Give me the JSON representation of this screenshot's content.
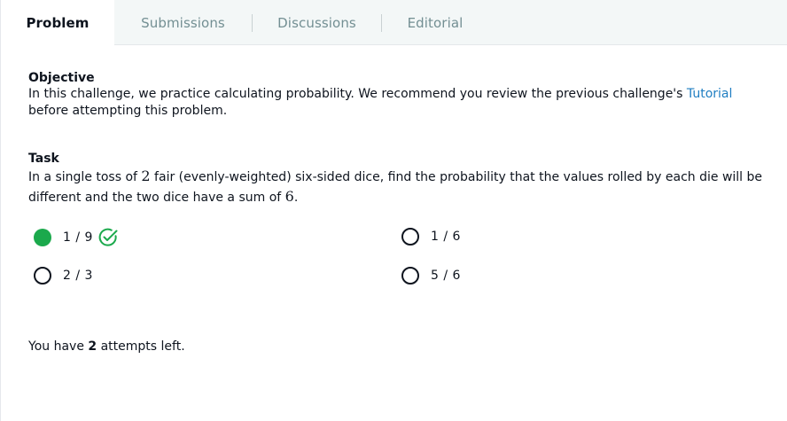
{
  "tabs": [
    {
      "label": "Problem",
      "active": true
    },
    {
      "label": "Submissions",
      "active": false
    },
    {
      "label": "Discussions",
      "active": false
    },
    {
      "label": "Editorial",
      "active": false
    }
  ],
  "objective": {
    "heading": "Objective",
    "text_before": "In this challenge, we practice calculating probability. We recommend you review the previous challenge's ",
    "link": "Tutorial",
    "text_after": " before attempting this problem."
  },
  "task": {
    "heading": "Task",
    "text_1": "In a single toss of ",
    "num_dice": "2",
    "text_2": " fair (evenly-weighted) six-sided dice, find the probability that the values rolled by each die will be different and the two dice have a sum of ",
    "sum": "6",
    "text_3": "."
  },
  "options": [
    {
      "label": "1 / 9",
      "selected": true,
      "correct": true
    },
    {
      "label": "1 / 6",
      "selected": false
    },
    {
      "label": "2 / 3",
      "selected": false
    },
    {
      "label": "5 / 6",
      "selected": false
    }
  ],
  "attempts": {
    "prefix": "You have ",
    "count": "2",
    "suffix": " attempts left."
  },
  "colors": {
    "selected_green": "#1ba94c",
    "link_blue": "#1f7ec2",
    "tab_bg": "#f3f7f7"
  }
}
